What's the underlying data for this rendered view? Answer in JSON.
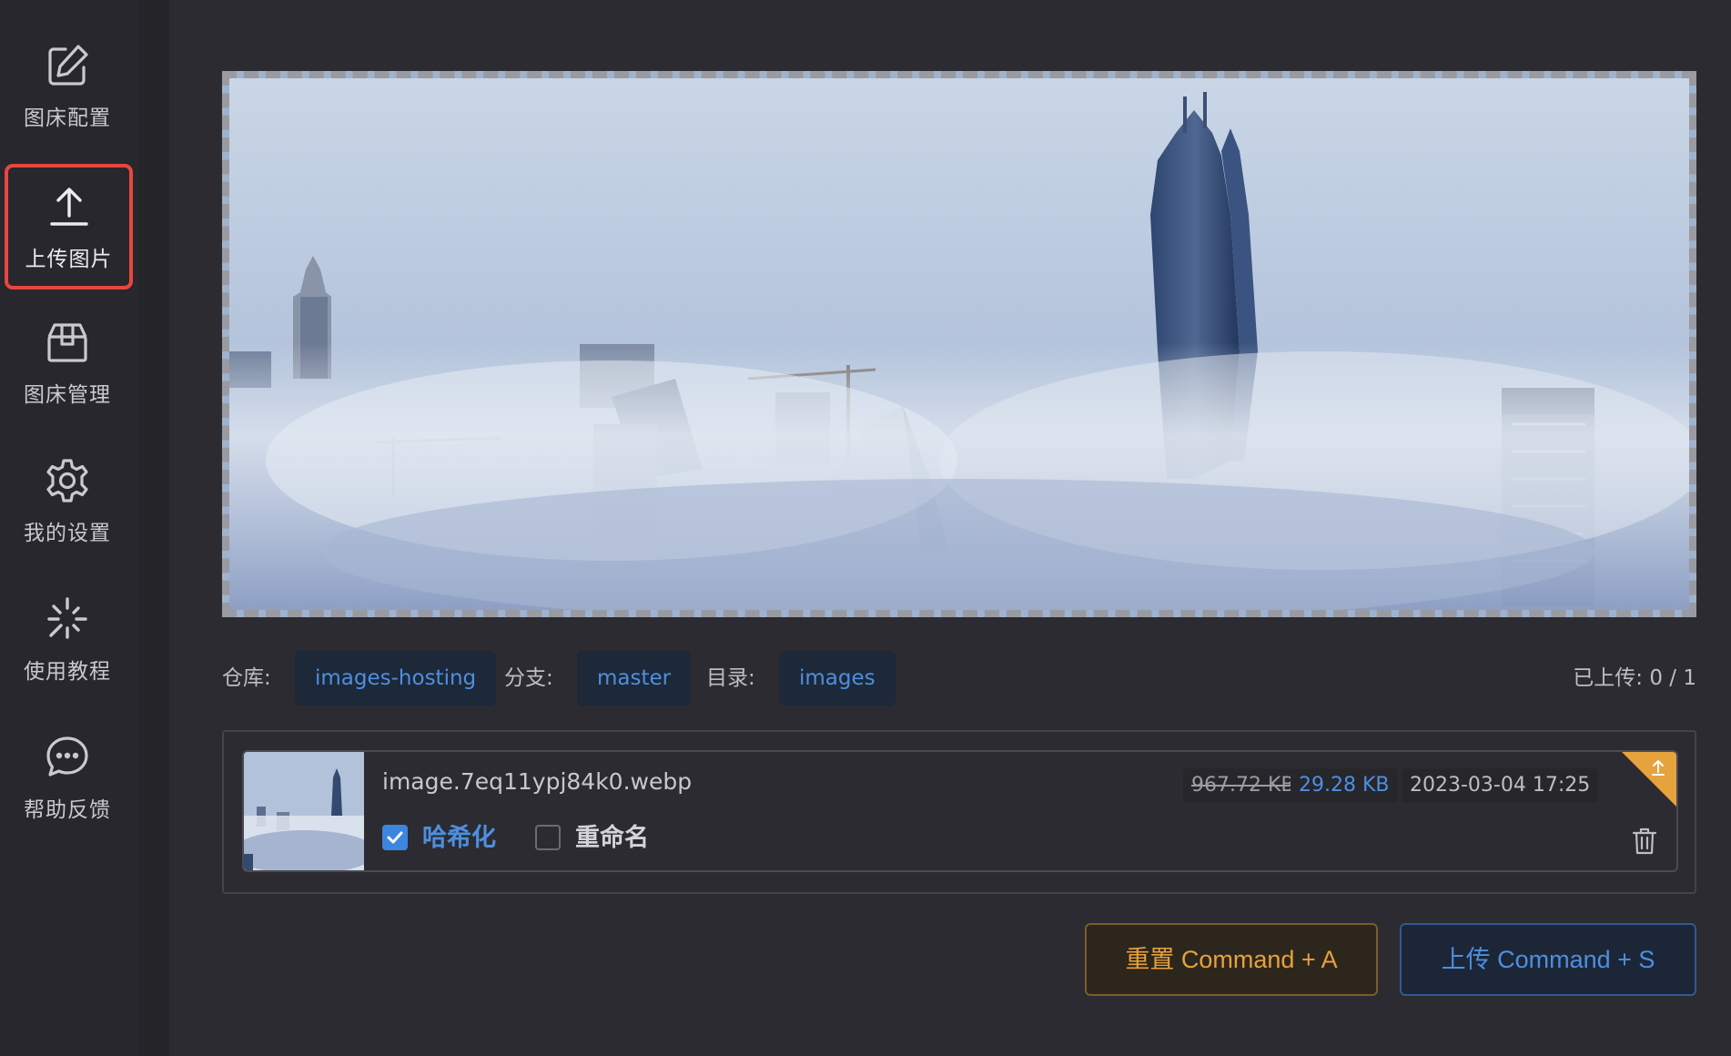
{
  "sidebar": {
    "items": [
      {
        "label": "图床配置",
        "icon": "edit-icon"
      },
      {
        "label": "上传图片",
        "icon": "upload-icon",
        "active": true
      },
      {
        "label": "图床管理",
        "icon": "box-icon"
      },
      {
        "label": "我的设置",
        "icon": "gear-icon"
      },
      {
        "label": "使用教程",
        "icon": "sparkle-icon"
      },
      {
        "label": "帮助反馈",
        "icon": "chat-icon"
      }
    ]
  },
  "repo_info": {
    "repo_label": "仓库:",
    "repo_value": "images-hosting",
    "branch_label": "分支:",
    "branch_value": "master",
    "dir_label": "目录:",
    "dir_value": "images",
    "uploaded_label": "已上传: 0 / 1"
  },
  "file": {
    "name": "image.7eq11ypj84k0.webp",
    "original_size": "967.72 KB",
    "compressed_size": "29.28 KB",
    "date": "2023-03-04 17:25",
    "hash_label": "哈希化",
    "hash_checked": true,
    "rename_label": "重命名",
    "rename_checked": false
  },
  "buttons": {
    "reset": "重置 Command + A",
    "upload": "上传 Command + S"
  },
  "colors": {
    "accent_blue": "#4d8fe0",
    "warning_orange": "#e6a23c",
    "active_border": "#e8473e"
  }
}
